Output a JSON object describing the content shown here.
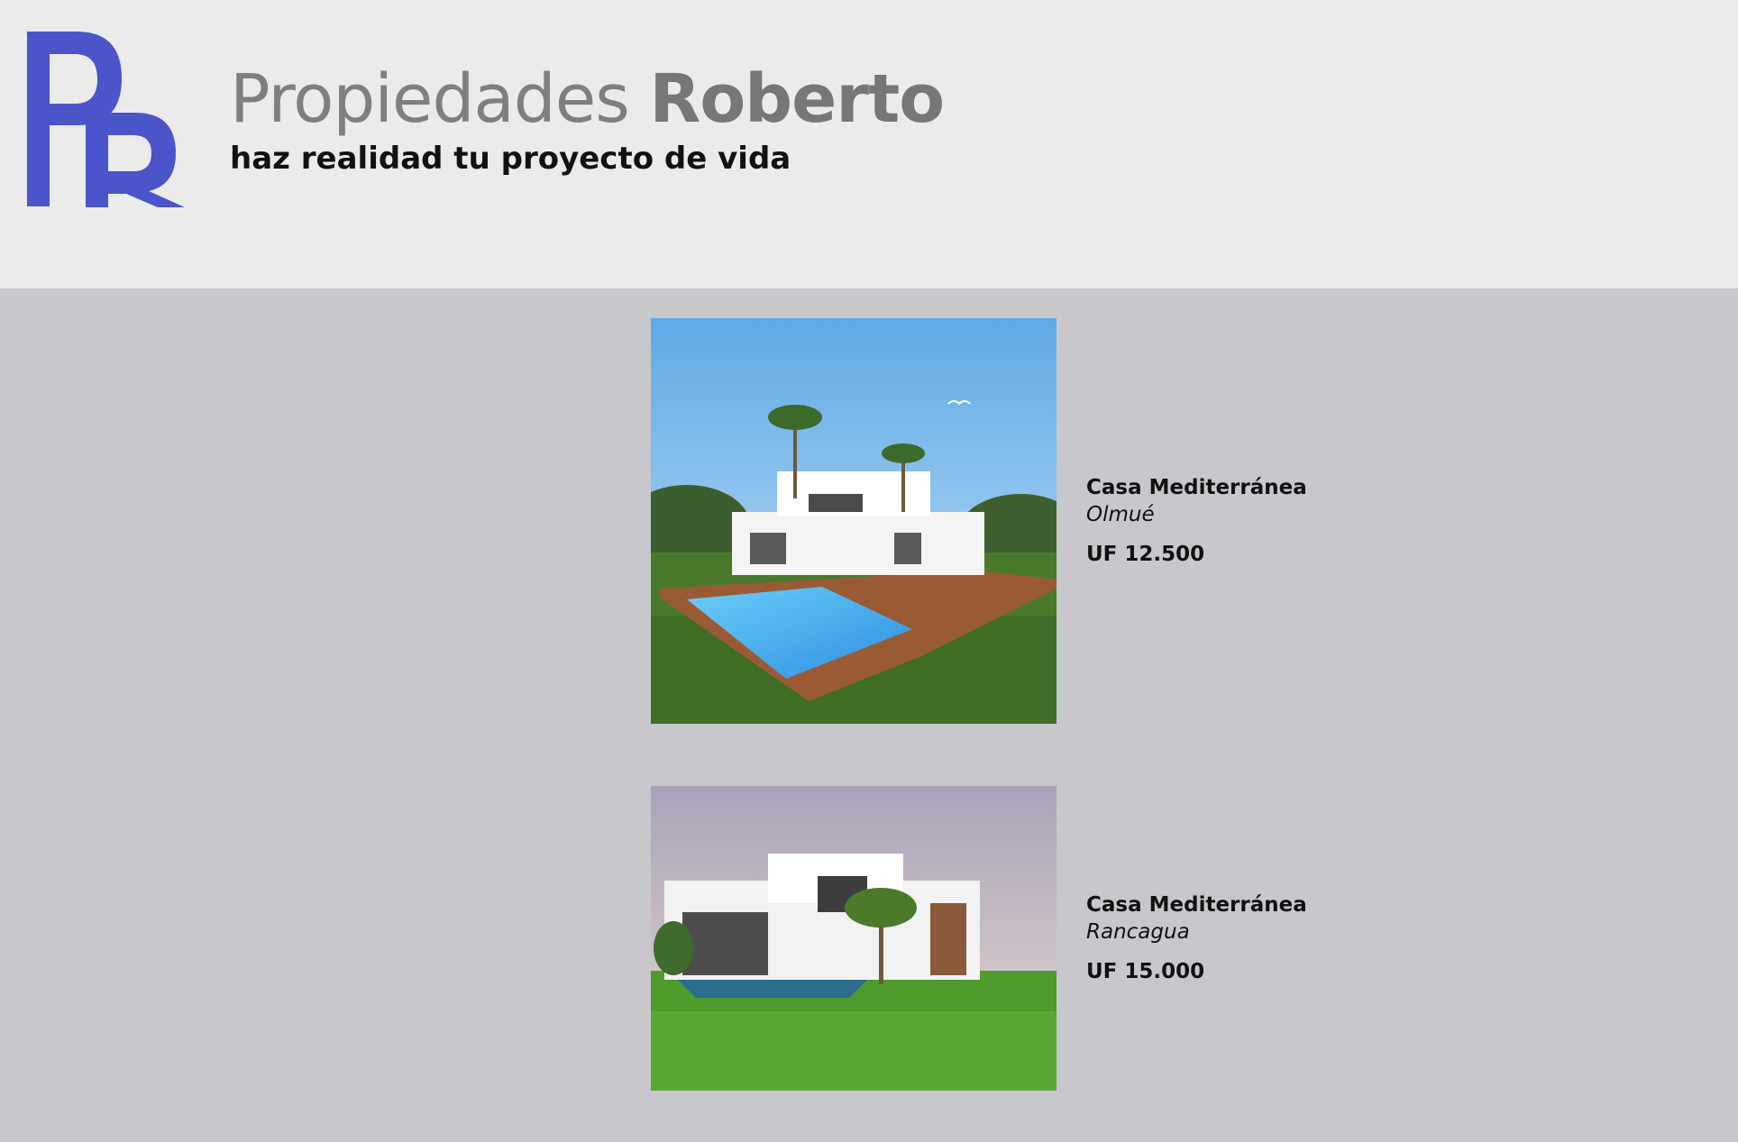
{
  "header": {
    "brand_light": "Propiedades ",
    "brand_bold": "Roberto",
    "tagline": "haz realidad tu proyecto de vida",
    "logo_letters": "PR",
    "logo_color": "#4b55c9"
  },
  "listings": [
    {
      "title": "Casa Mediterránea",
      "location": "Olmué",
      "price": "UF 12.500",
      "photo": "modern-white-villa-with-pool"
    },
    {
      "title": "Casa Mediterránea",
      "location": "Rancagua",
      "price": "UF 15.000",
      "photo": "modern-white-house-with-lawn"
    }
  ],
  "colors": {
    "header_bg": "#ebebeb",
    "page_bg": "#c8c7cc",
    "brand_text": "#7f7f7f"
  }
}
